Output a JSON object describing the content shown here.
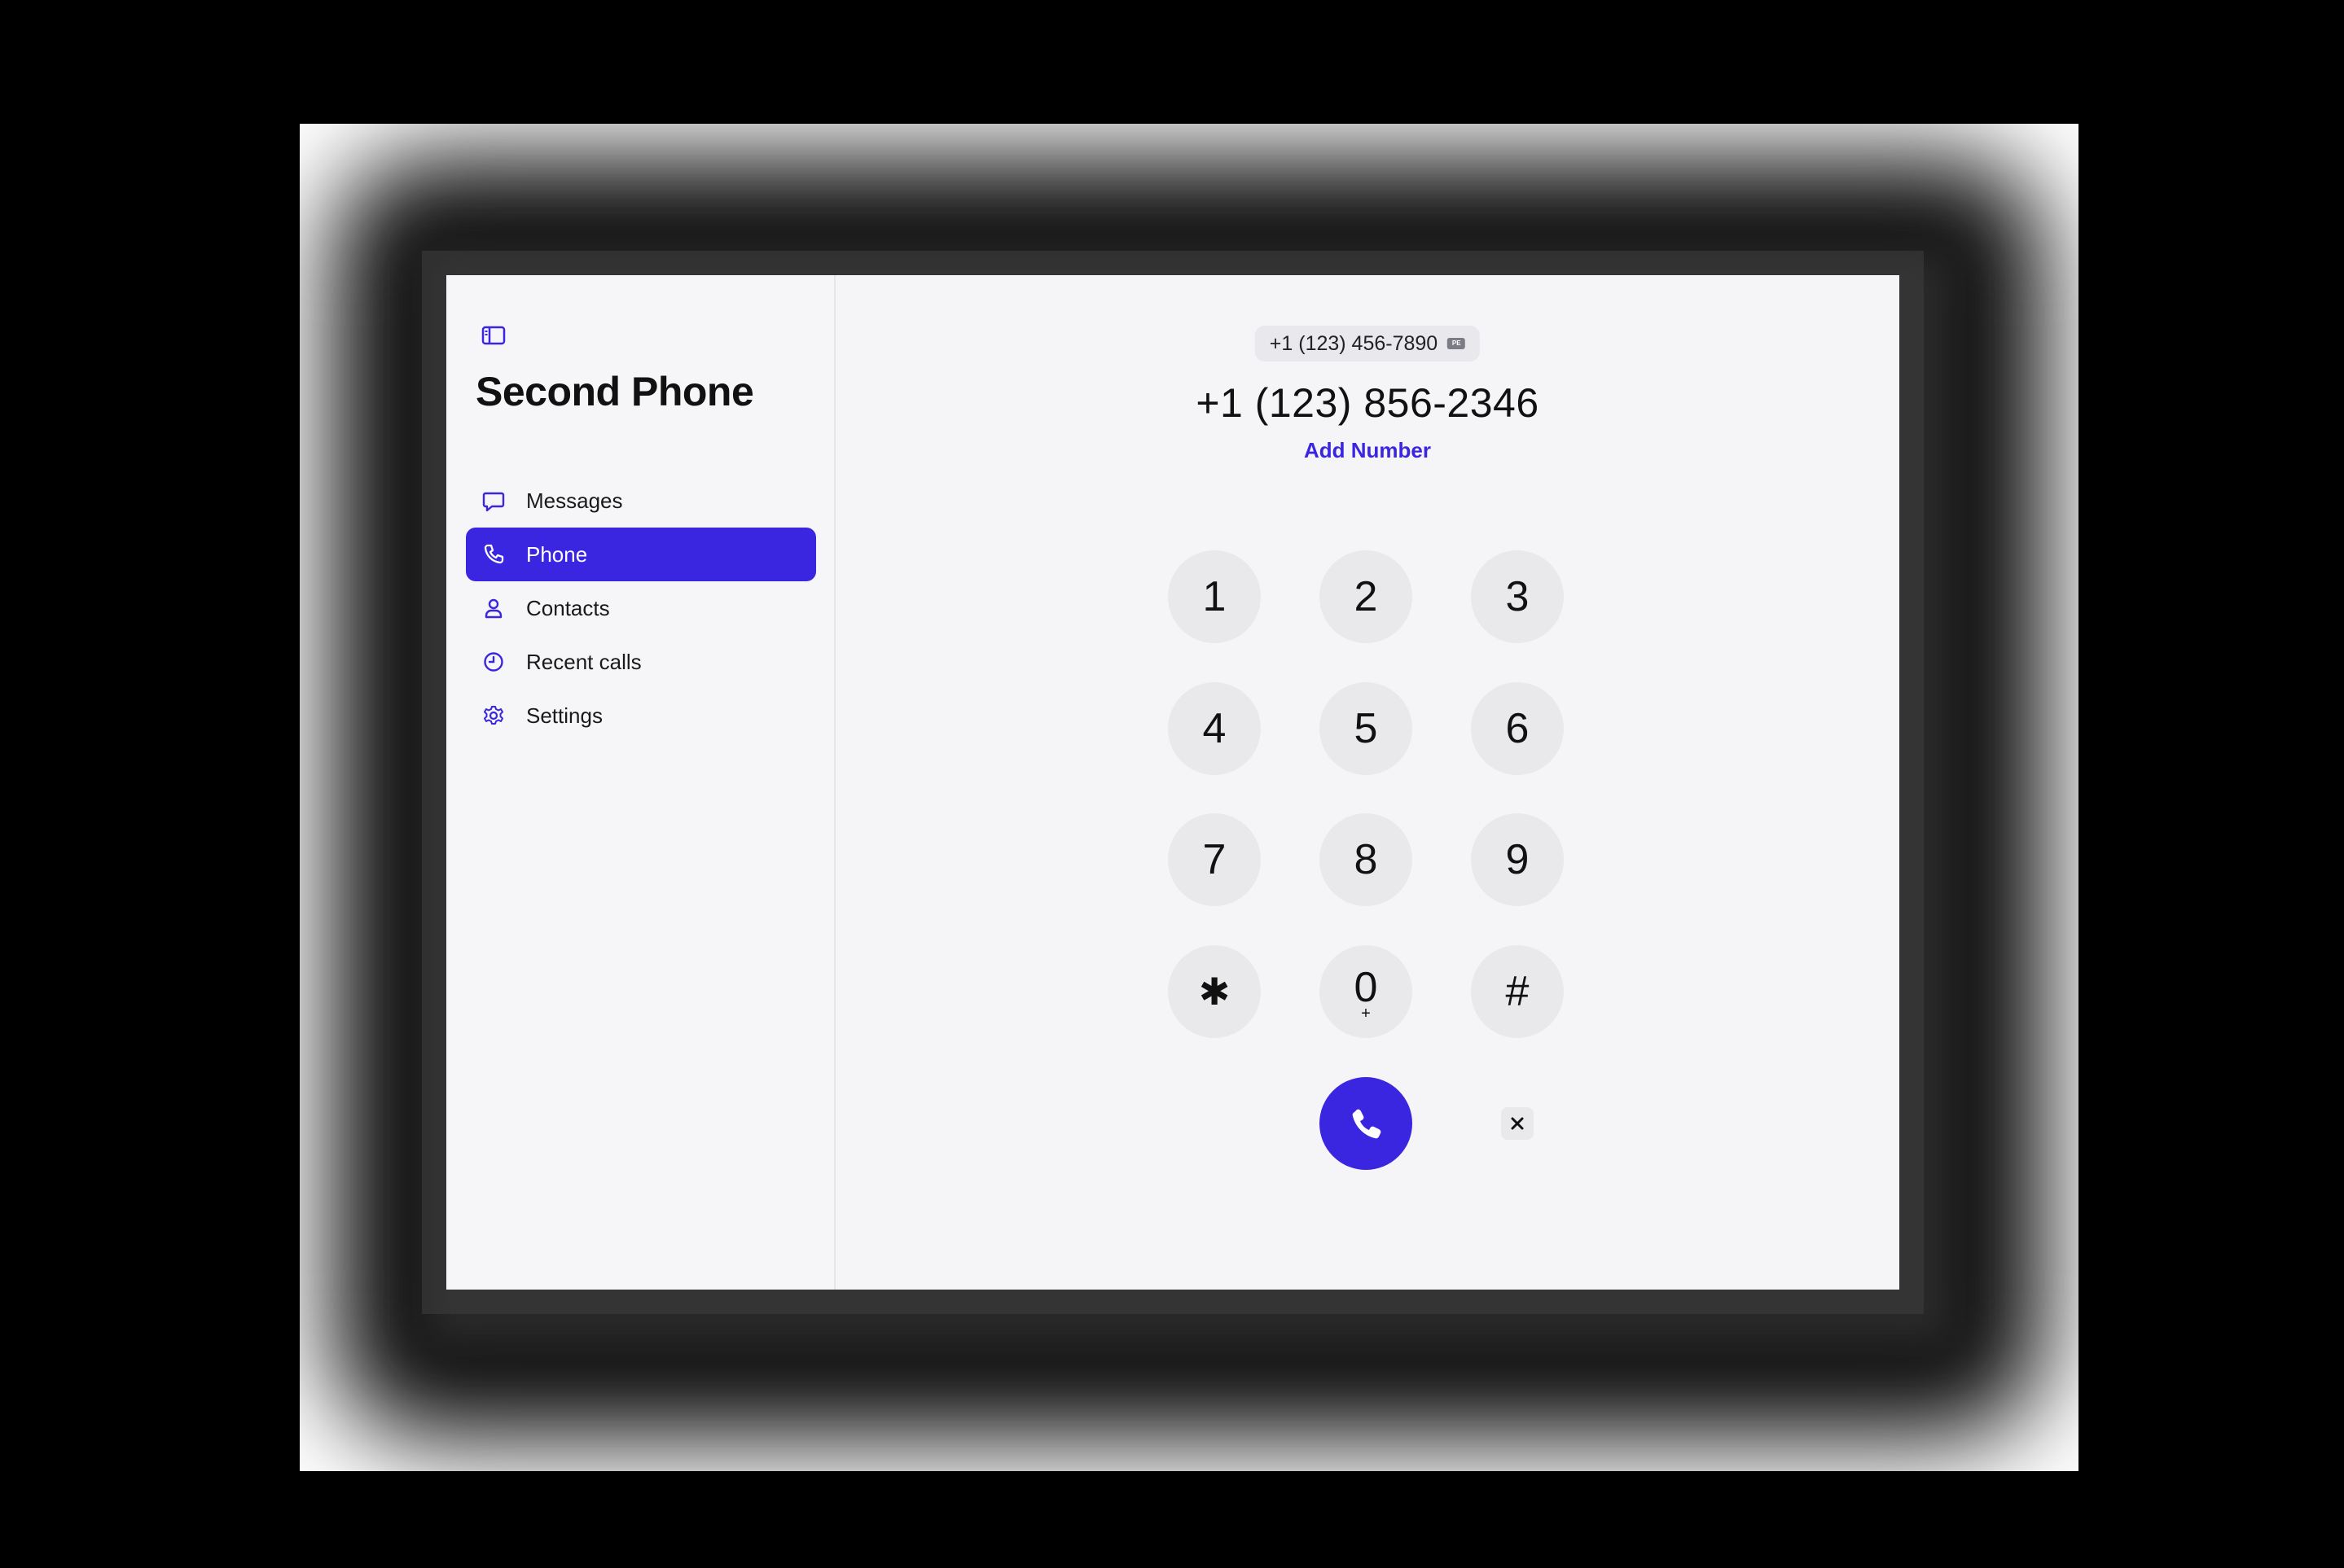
{
  "app": {
    "title": "Second Phone"
  },
  "sidebar": {
    "toggle_icon": "sidebar-toggle-icon",
    "items": [
      {
        "label": "Messages",
        "icon": "message-bubble-icon",
        "active": false
      },
      {
        "label": "Phone",
        "icon": "phone-icon",
        "active": true
      },
      {
        "label": "Contacts",
        "icon": "person-icon",
        "active": false
      },
      {
        "label": "Recent calls",
        "icon": "clock-icon",
        "active": false
      },
      {
        "label": "Settings",
        "icon": "gear-icon",
        "active": false
      }
    ]
  },
  "dialer": {
    "caller_id": "+1 (123) 456-7890",
    "caller_badge": "PE",
    "dialed_number": "+1 (123) 856-2346",
    "add_number_label": "Add Number",
    "keys": [
      {
        "digit": "1",
        "sub": ""
      },
      {
        "digit": "2",
        "sub": ""
      },
      {
        "digit": "3",
        "sub": ""
      },
      {
        "digit": "4",
        "sub": ""
      },
      {
        "digit": "5",
        "sub": ""
      },
      {
        "digit": "6",
        "sub": ""
      },
      {
        "digit": "7",
        "sub": ""
      },
      {
        "digit": "8",
        "sub": ""
      },
      {
        "digit": "9",
        "sub": ""
      },
      {
        "digit": "✱",
        "sub": ""
      },
      {
        "digit": "0",
        "sub": "+"
      },
      {
        "digit": "#",
        "sub": ""
      }
    ],
    "call_icon": "phone-icon",
    "delete_icon": "close-icon"
  },
  "colors": {
    "accent": "#3a25e0",
    "background": "#f5f5f7",
    "key_background": "#e9e9ec"
  }
}
